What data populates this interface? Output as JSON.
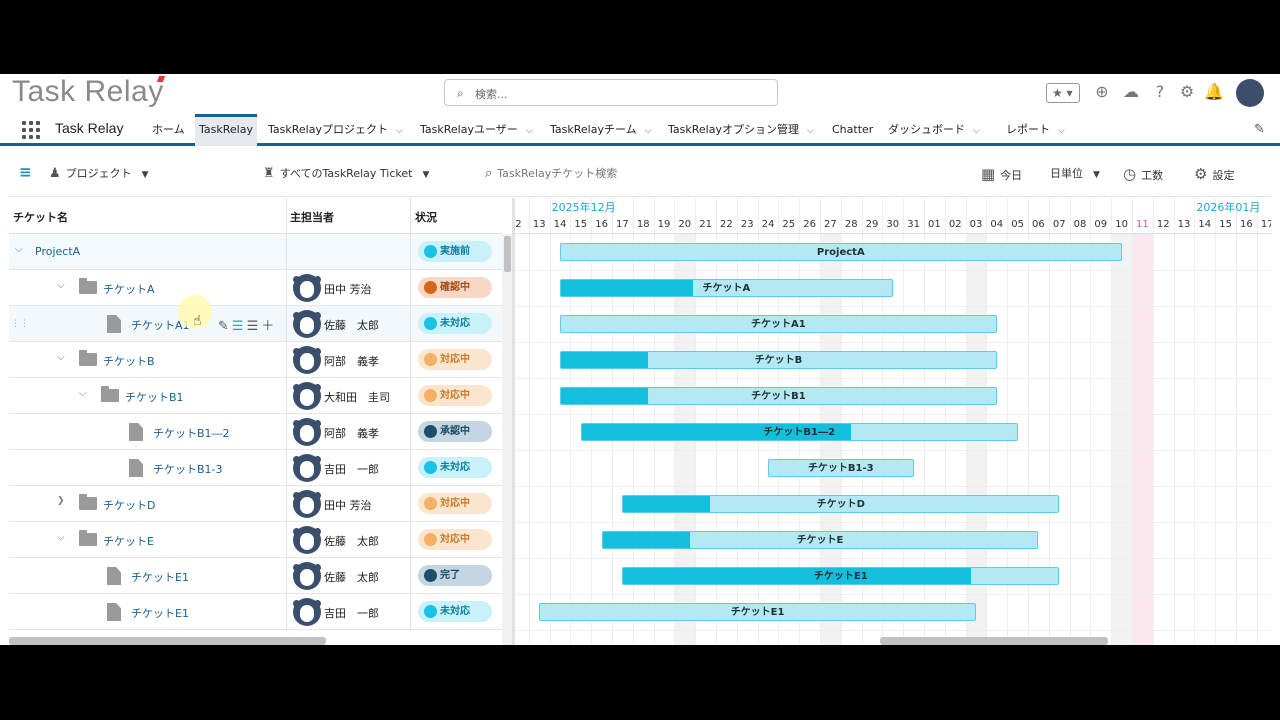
{
  "header": {
    "logo": "Task Relay",
    "search_placeholder": "検索..."
  },
  "nav": {
    "app_name": "Task Relay",
    "tabs": [
      {
        "label": "ホーム",
        "dropdown": false,
        "active": false
      },
      {
        "label": "TaskRelay",
        "dropdown": false,
        "active": true
      },
      {
        "label": "TaskRelayプロジェクト",
        "dropdown": true,
        "active": false
      },
      {
        "label": "TaskRelayユーザー",
        "dropdown": true,
        "active": false
      },
      {
        "label": "TaskRelayチーム",
        "dropdown": true,
        "active": false
      },
      {
        "label": "TaskRelayオプション管理",
        "dropdown": true,
        "active": false
      },
      {
        "label": "Chatter",
        "dropdown": false,
        "active": false
      },
      {
        "label": "ダッシュボード",
        "dropdown": true,
        "active": false
      },
      {
        "label": "レポート",
        "dropdown": true,
        "active": false
      }
    ]
  },
  "toolbar": {
    "project": "プロジェクト",
    "filter": "すべてのTaskRelay Ticket",
    "search_placeholder": "TaskRelayチケット検索",
    "today": "今日",
    "unit": "日単位",
    "effort": "工数",
    "settings": "設定"
  },
  "columns": {
    "ticket": "チケット名",
    "assignee": "主担当者",
    "status": "状況"
  },
  "rows": [
    {
      "name": "ProjectA",
      "kind": "project",
      "level": 0,
      "expanded": true,
      "assignee": "",
      "status": "実施前",
      "status_color": "cyan"
    },
    {
      "name": "チケットA",
      "kind": "folder",
      "level": 1,
      "expanded": true,
      "assignee": "田中 芳治",
      "status": "確認中",
      "status_color": "orange"
    },
    {
      "name": "チケットA1",
      "kind": "doc",
      "level": 2,
      "assignee": "佐藤　太郎",
      "status": "未対応",
      "status_color": "cyan",
      "hover": true
    },
    {
      "name": "チケットB",
      "kind": "folder",
      "level": 1,
      "expanded": true,
      "assignee": "阿部　義孝",
      "status": "対応中",
      "status_color": "peach"
    },
    {
      "name": "チケットB1",
      "kind": "folder",
      "level": 2,
      "expanded": true,
      "assignee": "大和田　圭司",
      "status": "対応中",
      "status_color": "peach"
    },
    {
      "name": "チケットB1―2",
      "kind": "doc",
      "level": 3,
      "assignee": "阿部　義孝",
      "status": "承認中",
      "status_color": "navy"
    },
    {
      "name": "チケットB1-3",
      "kind": "doc",
      "level": 3,
      "assignee": "吉田　一郎",
      "status": "未対応",
      "status_color": "cyan"
    },
    {
      "name": "チケットD",
      "kind": "folder",
      "level": 1,
      "expanded": false,
      "assignee": "田中 芳治",
      "status": "対応中",
      "status_color": "peach"
    },
    {
      "name": "チケットE",
      "kind": "folder",
      "level": 1,
      "expanded": true,
      "assignee": "佐藤　太郎",
      "status": "対応中",
      "status_color": "peach"
    },
    {
      "name": "チケットE1",
      "kind": "doc",
      "level": 2,
      "assignee": "佐藤　太郎",
      "status": "完了",
      "status_color": "navy"
    },
    {
      "name": "チケットE1",
      "kind": "doc",
      "level": 2,
      "assignee": "吉田　一郎",
      "status": "未対応",
      "status_color": "cyan"
    }
  ],
  "gantt": {
    "months": [
      {
        "label": "2025年12月",
        "start_day_index": 2
      },
      {
        "label": "2026年01月",
        "start_day_index": 33
      }
    ],
    "days": [
      "2",
      "13",
      "14",
      "15",
      "16",
      "17",
      "18",
      "19",
      "20",
      "21",
      "22",
      "23",
      "24",
      "25",
      "26",
      "27",
      "28",
      "29",
      "30",
      "31",
      "01",
      "02",
      "03",
      "04",
      "05",
      "06",
      "07",
      "08",
      "09",
      "10",
      "11",
      "12",
      "13",
      "14",
      "15",
      "16",
      "17"
    ],
    "weekend_day_indices": [
      8,
      15,
      22,
      29
    ],
    "today_day_index": 30,
    "bars": [
      {
        "label": "ProjectA",
        "row": 0,
        "start": 2.5,
        "end": 29.5,
        "progress": 0
      },
      {
        "label": "チケットA",
        "row": 1,
        "start": 2.5,
        "end": 18.5,
        "progress": 0.4
      },
      {
        "label": "チケットA1",
        "row": 2,
        "start": 2.5,
        "end": 23.5,
        "progress": 0
      },
      {
        "label": "チケットB",
        "row": 3,
        "start": 2.5,
        "end": 23.5,
        "progress": 0.2
      },
      {
        "label": "チケットB1",
        "row": 4,
        "start": 2.5,
        "end": 23.5,
        "progress": 0.2
      },
      {
        "label": "チケットB1―2",
        "row": 5,
        "start": 3.5,
        "end": 24.5,
        "progress": 0.62
      },
      {
        "label": "チケットB1-3",
        "row": 6,
        "start": 12.5,
        "end": 19.5,
        "progress": 0
      },
      {
        "label": "チケットD",
        "row": 7,
        "start": 5.5,
        "end": 26.5,
        "progress": 0.2
      },
      {
        "label": "チケットE",
        "row": 8,
        "start": 4.5,
        "end": 25.5,
        "progress": 0.2
      },
      {
        "label": "チケットE1",
        "row": 9,
        "start": 5.5,
        "end": 26.5,
        "progress": 0.8
      },
      {
        "label": "チケットE1",
        "row": 10,
        "start": 1.5,
        "end": 22.5,
        "progress": 0
      }
    ]
  }
}
